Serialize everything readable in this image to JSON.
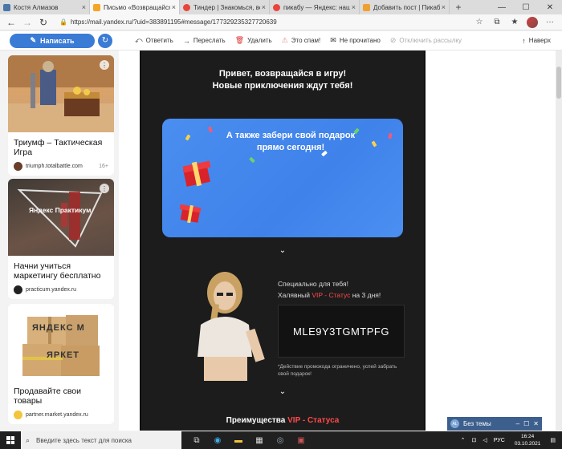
{
  "browser": {
    "tabs": [
      {
        "label": "Костя Алмазов",
        "color": "#4a76a8"
      },
      {
        "label": "Письмо «Возвращайся в",
        "color": "#f5a623"
      },
      {
        "label": "Тиндер | Знакомься, встр",
        "color": "#e8453c"
      },
      {
        "label": "пикабу — Яндекс: нашло",
        "color": "#e8453c"
      },
      {
        "label": "Добавить пост | Пикабу",
        "color": "#f0a030"
      }
    ],
    "url": "https://mail.yandex.ru/?uid=383891195#message/177329235327720639"
  },
  "mail_toolbar": {
    "compose": "Написать",
    "reply": "Ответить",
    "forward": "Переслать",
    "delete": "Удалить",
    "spam": "Это спам!",
    "unread": "Не прочитано",
    "unsubscribe": "Отключить рассылку",
    "up": "Наверх"
  },
  "ads": [
    {
      "title": "Триумф – Тактическая Игра",
      "source": "triumph.totalbattle.com",
      "age": "16+"
    },
    {
      "title": "Начни учиться маркетингу бесплатно",
      "source": "practicum.yandex.ru",
      "image_text": "Яндекс Практикум",
      "age": ""
    },
    {
      "title": "Продавайте свои товары",
      "source": "partner.market.yandex.ru",
      "image_text_1": "ЯНДЕКС М",
      "image_text_2": "ЯРКЕТ",
      "age": ""
    }
  ],
  "letter": {
    "greeting_1": "Привет, возвращайся в игру!",
    "greeting_2": "Новые приключения ждут тебя!",
    "gift_1": "А также забери свой подарок",
    "gift_2": "прямо сегодня!",
    "special": "Специально для тебя!",
    "vip_prefix": "Халявный ",
    "vip_word": "VIP - Статус",
    "vip_suffix": " на 3 дня!",
    "promo_code": "MLE9Y3TGMTPFG",
    "note": "*Действие промокода ограничено, успей забрать свой подарок!",
    "benefits_prefix": "Преимущества ",
    "benefits_vip": "VIP - Статуса"
  },
  "chat": {
    "label": "Без темы",
    "avatar": "AL"
  },
  "taskbar": {
    "search_placeholder": "Введите здесь текст для поиска",
    "lang": "РУС",
    "time": "16:24",
    "date": "03.10.2021"
  }
}
